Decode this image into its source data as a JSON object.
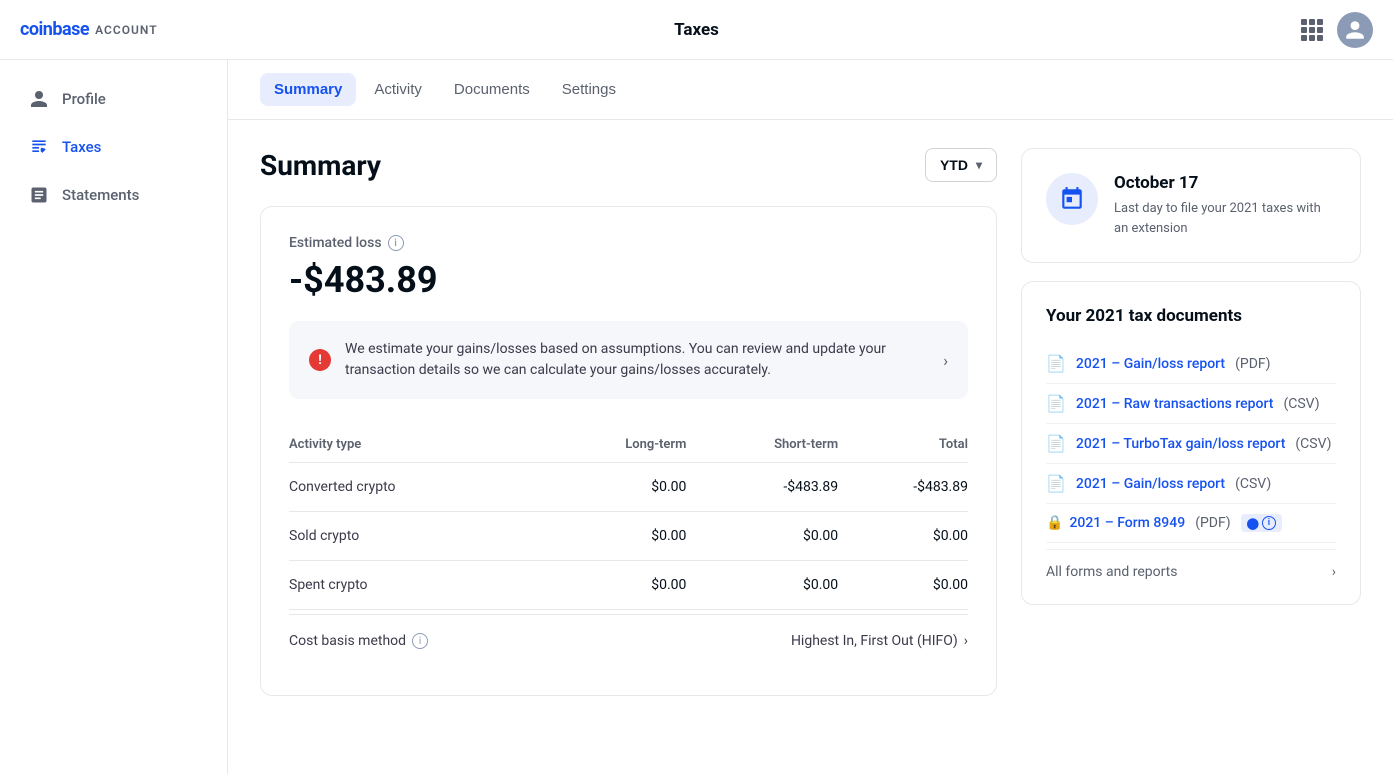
{
  "topnav": {
    "brand_name": "coinbase",
    "account_label": "ACCOUNT",
    "page_title": "Taxes"
  },
  "sidebar": {
    "items": [
      {
        "id": "profile",
        "label": "Profile",
        "icon": "person-icon",
        "active": false
      },
      {
        "id": "taxes",
        "label": "Taxes",
        "icon": "taxes-icon",
        "active": true
      },
      {
        "id": "statements",
        "label": "Statements",
        "icon": "statements-icon",
        "active": false
      }
    ]
  },
  "tabs": [
    {
      "id": "summary",
      "label": "Summary",
      "active": true
    },
    {
      "id": "activity",
      "label": "Activity",
      "active": false
    },
    {
      "id": "documents",
      "label": "Documents",
      "active": false
    },
    {
      "id": "settings",
      "label": "Settings",
      "active": false
    }
  ],
  "summary": {
    "title": "Summary",
    "ytd_label": "YTD",
    "estimated_label": "Estimated loss",
    "estimated_amount": "-$483.89",
    "warning_text": "We estimate your gains/losses based on assumptions. You can review and update your transaction details so we can calculate your gains/losses accurately.",
    "table": {
      "headers": [
        "Activity type",
        "Long-term",
        "Short-term",
        "Total"
      ],
      "rows": [
        {
          "type": "Converted crypto",
          "long_term": "$0.00",
          "short_term": "-$483.89",
          "total": "-$483.89"
        },
        {
          "type": "Sold crypto",
          "long_term": "$0.00",
          "short_term": "$0.00",
          "total": "$0.00"
        },
        {
          "type": "Spent crypto",
          "long_term": "$0.00",
          "short_term": "$0.00",
          "total": "$0.00"
        }
      ]
    },
    "cost_basis_label": "Cost basis method",
    "cost_basis_value": "Highest In, First Out (HIFO)"
  },
  "side_calendar": {
    "date": "October 17",
    "description": "Last day to file your 2021 taxes with an extension"
  },
  "tax_docs": {
    "title": "Your 2021 tax documents",
    "docs": [
      {
        "id": "gain-loss-pdf",
        "link_text": "2021 – Gain/loss report",
        "format": "(PDF)",
        "locked": false,
        "badge": null
      },
      {
        "id": "raw-transactions",
        "link_text": "2021 – Raw transactions report",
        "format": "(CSV)",
        "locked": false,
        "badge": null
      },
      {
        "id": "turbotax",
        "link_text": "2021 – TurboTax gain/loss report",
        "format": "(CSV)",
        "locked": false,
        "badge": null
      },
      {
        "id": "gain-loss-csv",
        "link_text": "2021 – Gain/loss report",
        "format": "(CSV)",
        "locked": false,
        "badge": null
      },
      {
        "id": "form-8949",
        "link_text": "2021 – Form 8949",
        "format": "(PDF)",
        "locked": true,
        "badge": "badge"
      }
    ],
    "all_forms_label": "All forms and reports"
  }
}
